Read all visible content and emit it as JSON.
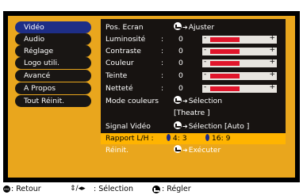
{
  "menu": {
    "items": [
      {
        "label": "Vidéo",
        "selected": true
      },
      {
        "label": "Audio"
      },
      {
        "label": "Réglage"
      },
      {
        "label": "Logo utili."
      },
      {
        "label": "Avancé"
      },
      {
        "label": "A Propos"
      },
      {
        "label": "Tout Réinit."
      }
    ]
  },
  "settings": {
    "pos_ecran": {
      "label": "Pos. Ecran",
      "action": "Ajuster"
    },
    "luminosite": {
      "label": "Luminosité",
      "colon": ":",
      "value": "0",
      "level": 0.5
    },
    "contraste": {
      "label": "Contraste",
      "colon": ":",
      "value": "0",
      "level": 0.5
    },
    "couleur": {
      "label": "Couleur",
      "colon": ":",
      "value": "0",
      "level": 0.5
    },
    "teinte": {
      "label": "Teinte",
      "colon": ":",
      "value": "0",
      "level": 0.5
    },
    "nettete": {
      "label": "Netteté",
      "colon": ":",
      "value": "0",
      "level": 0.5
    },
    "mode_couleurs": {
      "label": "Mode couleurs",
      "action": "Sélection",
      "current": "[Theatre          ]"
    },
    "signal_video": {
      "label": "Signal Vidéo",
      "action": "Sélection [Auto     ]"
    },
    "rapport": {
      "label": "Rapport L/H :",
      "opt1": "4: 3",
      "opt2": "16: 9"
    },
    "reinit": {
      "label": "Réinit.",
      "action": "Exécuter"
    }
  },
  "status_bar": {
    "retour": ": Retour",
    "updown": "⇕/◂▸",
    "selection": ": Sélection",
    "regler": ": Régler"
  },
  "colors": {
    "panel": "#e9a61d",
    "selected_menu": "#1e2e86",
    "highlight_row": "#ffb400",
    "bar_fill": "#e0152b"
  }
}
